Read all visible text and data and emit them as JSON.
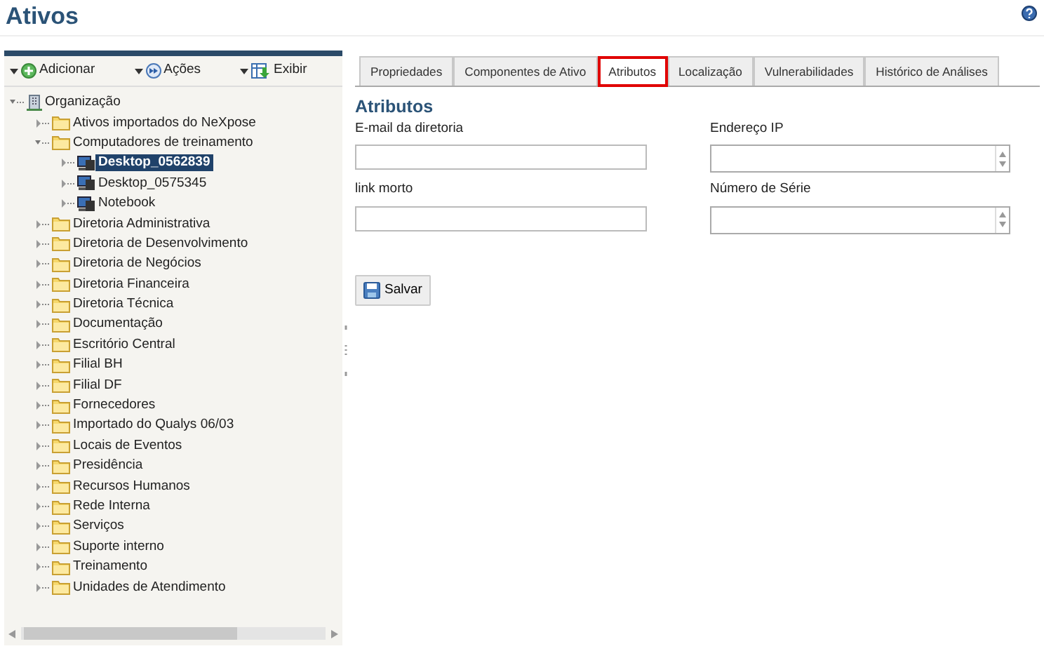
{
  "page": {
    "title": "Ativos"
  },
  "toolbar": [
    {
      "label": "Adicionar",
      "kind": "add"
    },
    {
      "label": "Ações",
      "kind": "actions"
    },
    {
      "label": "Exibir",
      "kind": "view"
    }
  ],
  "tree": [
    {
      "label": "Organização",
      "kind": "root",
      "expanded": true,
      "selected": false,
      "children": [
        {
          "label": "Ativos importados do NeXpose",
          "kind": "folder",
          "expanded": false,
          "selected": false
        },
        {
          "label": "Computadores de treinamento",
          "kind": "folder",
          "expanded": true,
          "selected": false,
          "children": [
            {
              "label": "Desktop_0562839",
              "kind": "computer",
              "expanded": false,
              "selected": true
            },
            {
              "label": "Desktop_0575345",
              "kind": "computer",
              "expanded": false,
              "selected": false
            },
            {
              "label": "Notebook",
              "kind": "computer",
              "expanded": false,
              "selected": false
            }
          ]
        },
        {
          "label": "Diretoria Administrativa",
          "kind": "folder",
          "expanded": false,
          "selected": false
        },
        {
          "label": "Diretoria de Desenvolvimento",
          "kind": "folder",
          "expanded": false,
          "selected": false
        },
        {
          "label": "Diretoria de Negócios",
          "kind": "folder",
          "expanded": false,
          "selected": false
        },
        {
          "label": "Diretoria Financeira",
          "kind": "folder",
          "expanded": false,
          "selected": false
        },
        {
          "label": "Diretoria Técnica",
          "kind": "folder",
          "expanded": false,
          "selected": false
        },
        {
          "label": "Documentação",
          "kind": "folder",
          "expanded": false,
          "selected": false
        },
        {
          "label": "Escritório Central",
          "kind": "folder",
          "expanded": false,
          "selected": false
        },
        {
          "label": "Filial BH",
          "kind": "folder",
          "expanded": false,
          "selected": false
        },
        {
          "label": "Filial DF",
          "kind": "folder",
          "expanded": false,
          "selected": false
        },
        {
          "label": "Fornecedores",
          "kind": "folder",
          "expanded": false,
          "selected": false
        },
        {
          "label": "Importado do Qualys 06/03",
          "kind": "folder",
          "expanded": false,
          "selected": false
        },
        {
          "label": "Locais de Eventos",
          "kind": "folder",
          "expanded": false,
          "selected": false
        },
        {
          "label": "Presidência",
          "kind": "folder",
          "expanded": false,
          "selected": false
        },
        {
          "label": "Recursos Humanos",
          "kind": "folder",
          "expanded": false,
          "selected": false
        },
        {
          "label": "Rede Interna",
          "kind": "folder",
          "expanded": false,
          "selected": false
        },
        {
          "label": "Serviços",
          "kind": "folder",
          "expanded": false,
          "selected": false
        },
        {
          "label": "Suporte interno",
          "kind": "folder",
          "expanded": false,
          "selected": false
        },
        {
          "label": "Treinamento",
          "kind": "folder",
          "expanded": false,
          "selected": false
        },
        {
          "label": "Unidades de Atendimento",
          "kind": "folder",
          "expanded": false,
          "selected": false
        }
      ]
    }
  ],
  "tabs": [
    {
      "label": "Propriedades",
      "selected": false
    },
    {
      "label": "Componentes de Ativo",
      "selected": false
    },
    {
      "label": "Atributos",
      "selected": true
    },
    {
      "label": "Localização",
      "selected": false
    },
    {
      "label": "Vulnerabilidades",
      "selected": false
    },
    {
      "label": "Histórico de Análises",
      "selected": false
    }
  ],
  "section": {
    "title": "Atributos"
  },
  "fields": [
    {
      "label": "E-mail da diretoria",
      "kind": "text"
    },
    {
      "label": "Endereço IP",
      "kind": "textarea"
    },
    {
      "label": "link morto",
      "kind": "text"
    },
    {
      "label": "Número de Série",
      "kind": "textarea"
    }
  ],
  "save_button": {
    "label": "Salvar"
  }
}
